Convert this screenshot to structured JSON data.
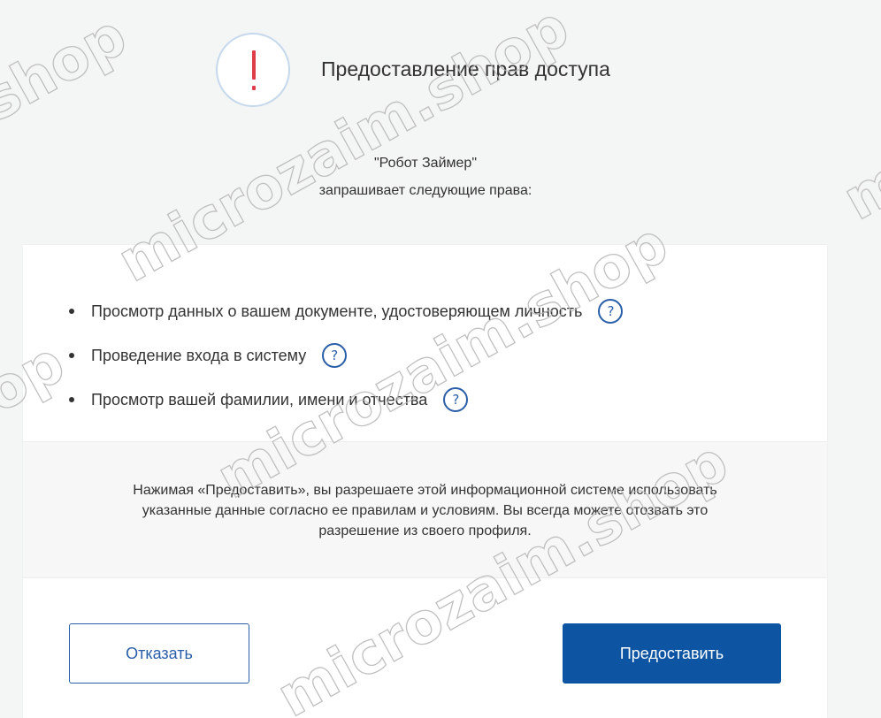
{
  "header": {
    "title": "Предоставление прав доступа",
    "icon": "alert-icon",
    "icon_color": "#e03d4b"
  },
  "requester": {
    "name": "\"Робот Займер\"",
    "text": "запрашивает следующие права:"
  },
  "permissions": [
    {
      "label": "Просмотр данных о вашем документе, удостоверяющем личность",
      "help": "?"
    },
    {
      "label": "Проведение входа в систему",
      "help": "?"
    },
    {
      "label": "Просмотр вашей фамилии, имени и отчества",
      "help": "?"
    }
  ],
  "notice": {
    "line1": "Нажимая «Предоставить», вы разрешаете этой информационной системе использовать",
    "line2": "указанные данные согласно ее правилам и условиям. Вы всегда можете отозвать это",
    "line3": "разрешение из своего профиля."
  },
  "buttons": {
    "decline_label": "Отказать",
    "grant_label": "Предоставить"
  },
  "watermark": {
    "text": "microzaim.shop"
  },
  "colors": {
    "accent": "#0d55a3",
    "link": "#2a5ea8",
    "background": "#f4f5f5"
  }
}
